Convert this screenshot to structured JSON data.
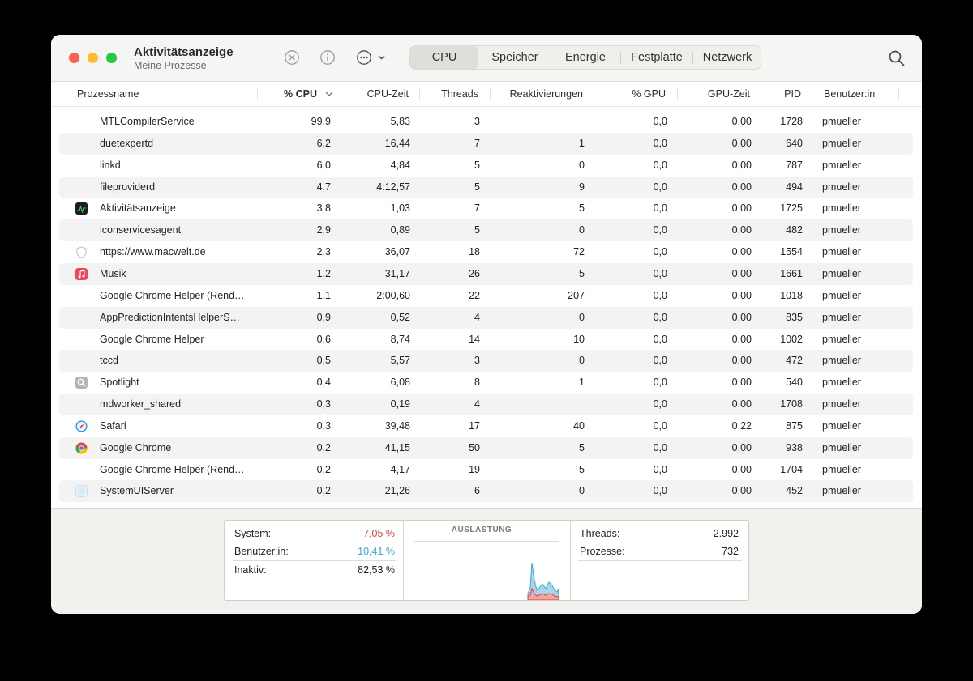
{
  "window": {
    "title": "Aktivitätsanzeige",
    "subtitle": "Meine Prozesse",
    "tabs": [
      {
        "label": "CPU",
        "active": true
      },
      {
        "label": "Speicher",
        "active": false
      },
      {
        "label": "Energie",
        "active": false
      },
      {
        "label": "Festplatte",
        "active": false
      },
      {
        "label": "Netzwerk",
        "active": false
      }
    ],
    "toolbar_icons": [
      "stop-process-icon",
      "info-icon",
      "more-actions-icon",
      "search-icon"
    ]
  },
  "table": {
    "columns": [
      "Prozessname",
      "% CPU",
      "CPU-Zeit",
      "Threads",
      "Reaktivierungen",
      "% GPU",
      "GPU-Zeit",
      "PID",
      "Benutzer:in"
    ],
    "sorted_column": "% CPU",
    "rows": [
      {
        "name": "MTLCompilerService",
        "icon": "",
        "cpu": "99,9",
        "cpu_time": "5,83",
        "threads": "3",
        "wakeups": "",
        "gpu": "0,0",
        "gpu_time": "0,00",
        "pid": "1728",
        "user": "pmueller"
      },
      {
        "name": "duetexpertd",
        "icon": "",
        "cpu": "6,2",
        "cpu_time": "16,44",
        "threads": "7",
        "wakeups": "1",
        "gpu": "0,0",
        "gpu_time": "0,00",
        "pid": "640",
        "user": "pmueller"
      },
      {
        "name": "linkd",
        "icon": "",
        "cpu": "6,0",
        "cpu_time": "4,84",
        "threads": "5",
        "wakeups": "0",
        "gpu": "0,0",
        "gpu_time": "0,00",
        "pid": "787",
        "user": "pmueller"
      },
      {
        "name": "fileproviderd",
        "icon": "",
        "cpu": "4,7",
        "cpu_time": "4:12,57",
        "threads": "5",
        "wakeups": "9",
        "gpu": "0,0",
        "gpu_time": "0,00",
        "pid": "494",
        "user": "pmueller"
      },
      {
        "name": "Aktivitätsanzeige",
        "icon": "activity-monitor-icon",
        "cpu": "3,8",
        "cpu_time": "1,03",
        "threads": "7",
        "wakeups": "5",
        "gpu": "0,0",
        "gpu_time": "0,00",
        "pid": "1725",
        "user": "pmueller"
      },
      {
        "name": "iconservicesagent",
        "icon": "",
        "cpu": "2,9",
        "cpu_time": "0,89",
        "threads": "5",
        "wakeups": "0",
        "gpu": "0,0",
        "gpu_time": "0,00",
        "pid": "482",
        "user": "pmueller"
      },
      {
        "name": "https://www.macwelt.de",
        "icon": "shield-icon",
        "cpu": "2,3",
        "cpu_time": "36,07",
        "threads": "18",
        "wakeups": "72",
        "gpu": "0,0",
        "gpu_time": "0,00",
        "pid": "1554",
        "user": "pmueller"
      },
      {
        "name": "Musik",
        "icon": "music-icon",
        "cpu": "1,2",
        "cpu_time": "31,17",
        "threads": "26",
        "wakeups": "5",
        "gpu": "0,0",
        "gpu_time": "0,00",
        "pid": "1661",
        "user": "pmueller"
      },
      {
        "name": "Google Chrome Helper (Rend…",
        "icon": "",
        "cpu": "1,1",
        "cpu_time": "2:00,60",
        "threads": "22",
        "wakeups": "207",
        "gpu": "0,0",
        "gpu_time": "0,00",
        "pid": "1018",
        "user": "pmueller"
      },
      {
        "name": "AppPredictionIntentsHelperS…",
        "icon": "",
        "cpu": "0,9",
        "cpu_time": "0,52",
        "threads": "4",
        "wakeups": "0",
        "gpu": "0,0",
        "gpu_time": "0,00",
        "pid": "835",
        "user": "pmueller"
      },
      {
        "name": "Google Chrome Helper",
        "icon": "",
        "cpu": "0,6",
        "cpu_time": "8,74",
        "threads": "14",
        "wakeups": "10",
        "gpu": "0,0",
        "gpu_time": "0,00",
        "pid": "1002",
        "user": "pmueller"
      },
      {
        "name": "tccd",
        "icon": "",
        "cpu": "0,5",
        "cpu_time": "5,57",
        "threads": "3",
        "wakeups": "0",
        "gpu": "0,0",
        "gpu_time": "0,00",
        "pid": "472",
        "user": "pmueller"
      },
      {
        "name": "Spotlight",
        "icon": "spotlight-icon",
        "cpu": "0,4",
        "cpu_time": "6,08",
        "threads": "8",
        "wakeups": "1",
        "gpu": "0,0",
        "gpu_time": "0,00",
        "pid": "540",
        "user": "pmueller"
      },
      {
        "name": "mdworker_shared",
        "icon": "",
        "cpu": "0,3",
        "cpu_time": "0,19",
        "threads": "4",
        "wakeups": "",
        "gpu": "0,0",
        "gpu_time": "0,00",
        "pid": "1708",
        "user": "pmueller"
      },
      {
        "name": "Safari",
        "icon": "safari-icon",
        "cpu": "0,3",
        "cpu_time": "39,48",
        "threads": "17",
        "wakeups": "40",
        "gpu": "0,0",
        "gpu_time": "0,22",
        "pid": "875",
        "user": "pmueller"
      },
      {
        "name": "Google Chrome",
        "icon": "chrome-icon",
        "cpu": "0,2",
        "cpu_time": "41,15",
        "threads": "50",
        "wakeups": "5",
        "gpu": "0,0",
        "gpu_time": "0,00",
        "pid": "938",
        "user": "pmueller"
      },
      {
        "name": "Google Chrome Helper (Rend…",
        "icon": "",
        "cpu": "0,2",
        "cpu_time": "4,17",
        "threads": "19",
        "wakeups": "5",
        "gpu": "0,0",
        "gpu_time": "0,00",
        "pid": "1704",
        "user": "pmueller"
      },
      {
        "name": "SystemUIServer",
        "icon": "systemuiserver-icon",
        "cpu": "0,2",
        "cpu_time": "21,26",
        "threads": "6",
        "wakeups": "0",
        "gpu": "0,0",
        "gpu_time": "0,00",
        "pid": "452",
        "user": "pmueller"
      }
    ]
  },
  "summary": {
    "system_label": "System:",
    "system_value": "7,05 %",
    "user_label": "Benutzer:in:",
    "user_value": "10,41 %",
    "idle_label": "Inaktiv:",
    "idle_value": "82,53 %",
    "graph_label": "AUSLASTUNG",
    "threads_label": "Threads:",
    "threads_value": "2.992",
    "processes_label": "Prozesse:",
    "processes_value": "732",
    "colors": {
      "system": "#e0443e",
      "user": "#3aa9d8"
    }
  }
}
